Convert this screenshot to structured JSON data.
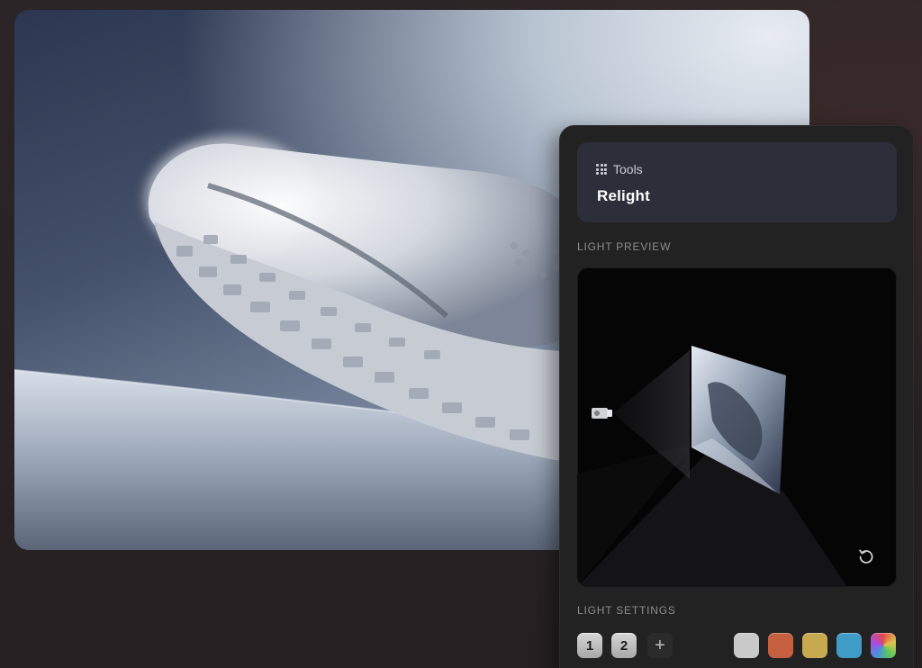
{
  "canvas": {
    "image_icon": "sneaker-render"
  },
  "panel": {
    "tools_icon": "grid-icon",
    "tools_label": "Tools",
    "tool_title": "Relight",
    "light_preview_label": "LIGHT PREVIEW",
    "reset_icon": "reset-icon",
    "light_settings_label": "LIGHT SETTINGS",
    "lights": [
      "1",
      "2"
    ],
    "add_light_label": "+",
    "swatches": [
      {
        "name": "white",
        "color": "#c9c9c9"
      },
      {
        "name": "orange",
        "color": "#c4603f"
      },
      {
        "name": "yellow",
        "color": "#c7aa4f"
      },
      {
        "name": "blue",
        "color": "#3f9cc6"
      },
      {
        "name": "multicolor",
        "color": "conic"
      }
    ]
  }
}
